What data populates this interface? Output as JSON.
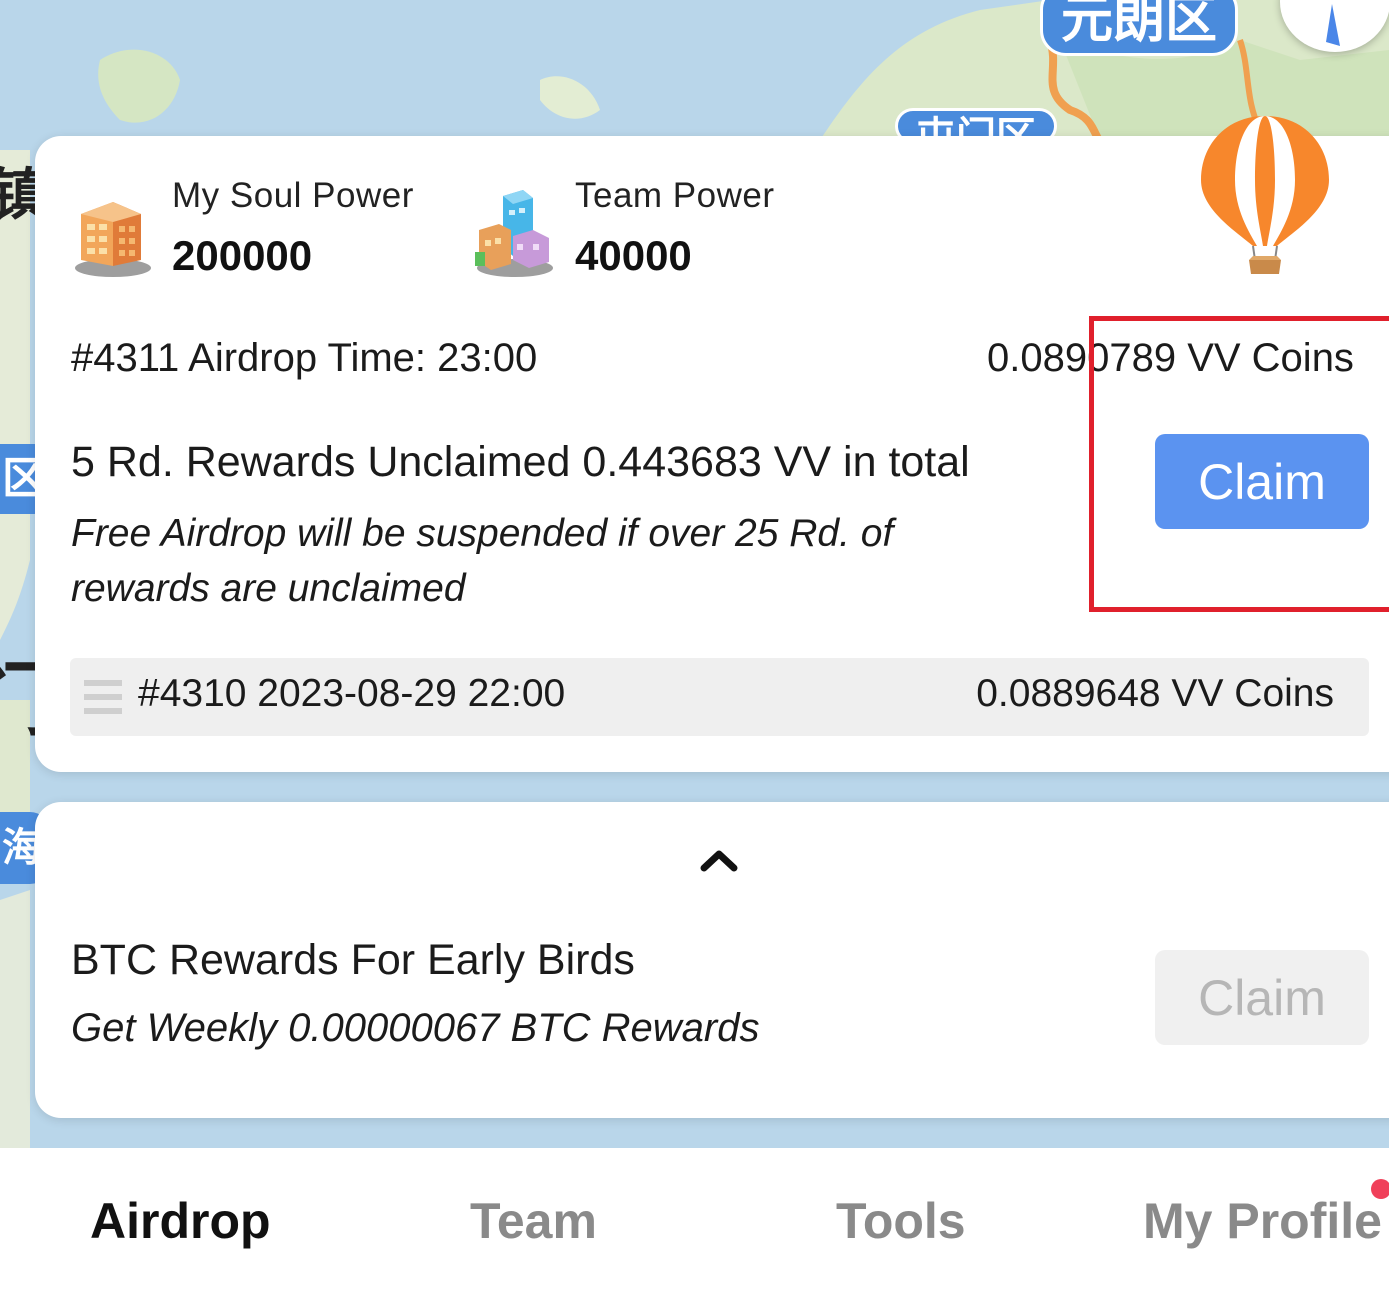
{
  "map": {
    "labels": [
      "元朗区",
      "屯门区",
      "区",
      "海"
    ],
    "edge_glyphs": [
      "镇",
      "门"
    ]
  },
  "stats": {
    "soul_power": {
      "label": "My Soul Power",
      "value": "200000",
      "icon": "office-building-icon"
    },
    "team_power": {
      "label": "Team Power",
      "value": "40000",
      "icon": "city-buildings-icon"
    },
    "balloon_icon": "hot-air-balloon-icon"
  },
  "airdrop": {
    "current_round": "#4311 Airdrop Time: 23:00",
    "current_amount": "0.0890789 VV Coins",
    "unclaimed_text": "5 Rd. Rewards Unclaimed 0.443683 VV in total",
    "warning_text": "Free Airdrop will be suspended if over 25 Rd. of rewards are unclaimed",
    "claim_label": "Claim",
    "claim_color": "#5b93f0",
    "highlight_color": "#e0202c",
    "history": {
      "round": "#4310 2023-08-29 22:00",
      "amount": "0.0889648 VV Coins"
    }
  },
  "btc": {
    "title": "BTC Rewards For Early Birds",
    "subtitle": "Get Weekly 0.00000067 BTC Rewards",
    "claim_label": "Claim",
    "claim_enabled": false
  },
  "tabs": [
    {
      "label": "Airdrop",
      "active": true
    },
    {
      "label": "Team",
      "active": false
    },
    {
      "label": "Tools",
      "active": false
    },
    {
      "label": "My Profile",
      "active": false,
      "notification": true
    }
  ]
}
